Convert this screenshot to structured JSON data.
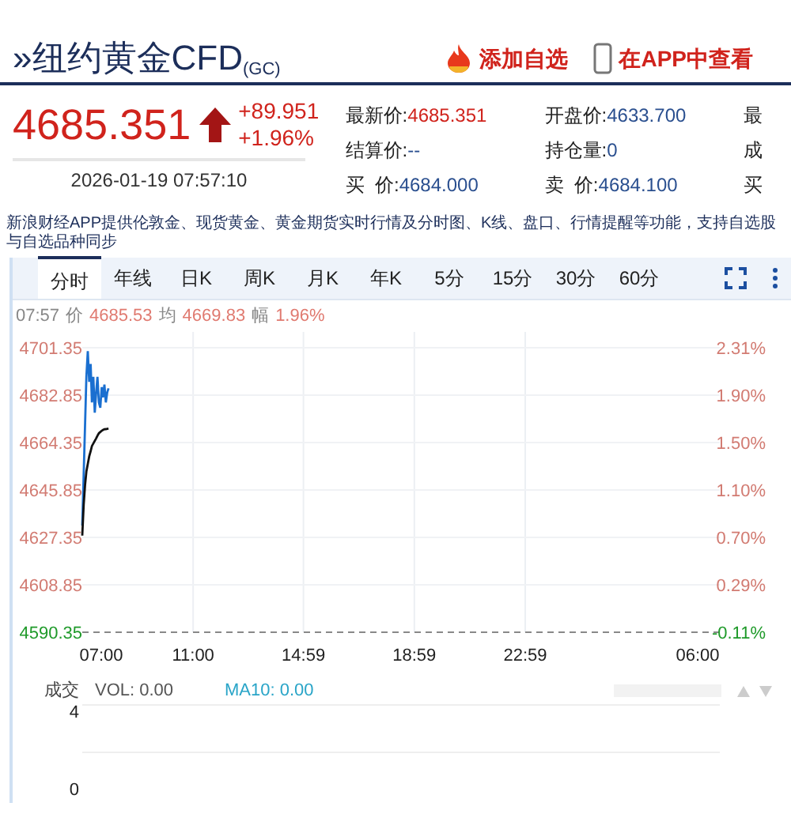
{
  "header": {
    "marker": "»",
    "title": "纽约黄金CFD$_{(GC)}$",
    "actions": [
      {
        "kind": "flame",
        "label": "添加自选"
      },
      {
        "kind": "phone",
        "label": "在APP中查看"
      }
    ]
  },
  "quote": {
    "price": "4685.351",
    "up": true,
    "change": "+89.951",
    "change_pct": "+1.96%",
    "timestamp": "2026-01-19 07:57:10",
    "rows": [
      [
        {
          "label": "最新价:",
          "value": "4685.351",
          "color": "#d0231c"
        },
        {
          "label": "开盘价:",
          "value": "4633.700",
          "color": "#2a4f8f"
        },
        {
          "label": "最"
        }
      ],
      [
        {
          "label": "结算价:",
          "value": "--",
          "color": "#2a4f8f"
        },
        {
          "label": "持仓量:",
          "value": "0",
          "color": "#2a4f8f"
        },
        {
          "label": "成"
        }
      ],
      [
        {
          "label": "买  价:",
          "value": "4684.000",
          "color": "#2a4f8f"
        },
        {
          "label": "卖  价:",
          "value": "4684.100",
          "color": "#2a4f8f"
        },
        {
          "label": "买"
        }
      ]
    ]
  },
  "notice": "新浪财经APP提供伦敦金、现货黄金、黄金期货实时行情及分时图、K线、盘口、行情提醒等功能，支持自选股与自选品种同步",
  "tabs": [
    {
      "label": "分时",
      "selected": true
    },
    {
      "label": "年线",
      "selected": false
    },
    {
      "label": "日K",
      "selected": false
    },
    {
      "label": "周K",
      "selected": false
    },
    {
      "label": "月K",
      "selected": false
    },
    {
      "label": "年K",
      "selected": false
    },
    {
      "label": "5分",
      "selected": false
    },
    {
      "label": "15分",
      "selected": false
    },
    {
      "label": "30分",
      "selected": false
    },
    {
      "label": "60分",
      "selected": false
    }
  ],
  "chart_info": {
    "time": "07:57",
    "items": [
      {
        "label": "价",
        "value": "4685.53"
      },
      {
        "label": "均",
        "value": "4669.83"
      },
      {
        "label": "幅",
        "value": "1.96%"
      }
    ]
  },
  "chart": {
    "axis_end_label": "06:00",
    "percent_labels": [
      "2.31%",
      "1.90%",
      "1.50%",
      "1.10%",
      "0.70%",
      "0.29%",
      "-0.11%"
    ],
    "chart_data": {
      "type": "line",
      "xlim": [
        7,
        30
      ],
      "ylim": [
        4590.35,
        4701.35
      ],
      "xticks": [
        {
          "value": 7,
          "label": "07:00"
        },
        {
          "value": 11,
          "label": "11:00"
        },
        {
          "value": 14.98,
          "label": "14:59"
        },
        {
          "value": 18.98,
          "label": "18:59"
        },
        {
          "value": 22.98,
          "label": "22:59"
        }
      ],
      "grid": true,
      "yticks": [
        4701.35,
        4682.85,
        4664.35,
        4645.85,
        4627.35,
        4608.85,
        4590.35
      ],
      "x": [
        7,
        7.05,
        7.1,
        7.15,
        7.2,
        7.25,
        7.3,
        7.35,
        7.4,
        7.45,
        7.5,
        7.55,
        7.6,
        7.65,
        7.7,
        7.75,
        7.8,
        7.85,
        7.9,
        7.95
      ],
      "series": [
        {
          "color": "#1a6fd0",
          "values": [
            4632,
            4652,
            4672,
            4690,
            4700,
            4688,
            4695,
            4680,
            4690,
            4676,
            4684,
            4690,
            4680,
            4678,
            4686,
            4682,
            4687,
            4680,
            4684,
            4685.5
          ]
        },
        {
          "color": "#111111",
          "values": [
            4628,
            4640,
            4648,
            4653,
            4656,
            4659,
            4661,
            4663,
            4664,
            4665,
            4666,
            4667,
            4668,
            4668.5,
            4669,
            4669.3,
            4669.5,
            4669.6,
            4669.7,
            4669.8
          ]
        }
      ]
    }
  },
  "volume": {
    "title": "成交",
    "vol": "VOL: 0.00",
    "ma": "MA10: 0.00",
    "ticks": [
      "4",
      "0"
    ]
  }
}
